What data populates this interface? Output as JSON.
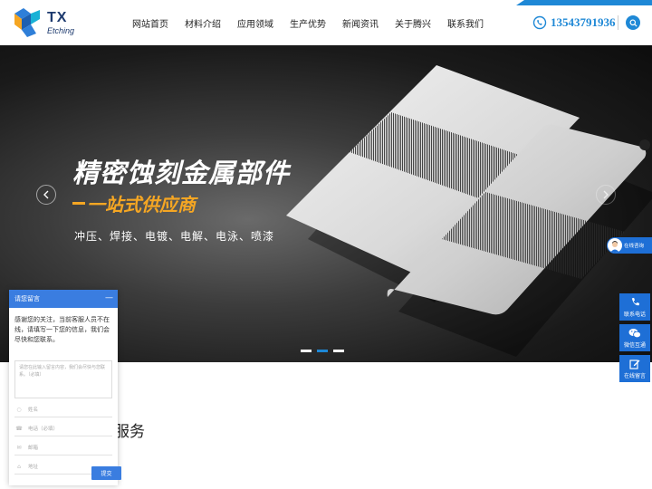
{
  "header": {
    "logo_tx": "TX",
    "logo_sub": "Etching",
    "phone": "13543791936",
    "accent_color": "#1e88d6"
  },
  "nav": {
    "items": [
      "网站首页",
      "材料介绍",
      "应用领域",
      "生产优势",
      "新闻资讯",
      "关于腾兴",
      "联系我们"
    ]
  },
  "banner": {
    "title": "精密蚀刻金属部件",
    "subtitle": "一站式供应商",
    "services": "冲压、焊接、电镀、电解、电泳、喷漆",
    "active_slide": 2,
    "slide_count": 3,
    "highlight_color": "#f5a623"
  },
  "section": {
    "title_fragment": "服务"
  },
  "message_widget": {
    "header": "请您留言",
    "minimize": "—",
    "intro": "感谢您的关注，当前客服人员不在线，请填写一下您的信息，我们会尽快和您联系。",
    "textarea_placeholder": "请您在此输入留言内容，我们会尽快与您联系。（必填）",
    "name_placeholder": "姓名",
    "phone_placeholder": "电话（必填）",
    "email_placeholder": "邮箱",
    "address_placeholder": "地址",
    "submit": "提交"
  },
  "float_bar": {
    "consult": "在线咨询",
    "phone": "联系电话",
    "wechat": "微信互通",
    "message": "在线留言"
  }
}
